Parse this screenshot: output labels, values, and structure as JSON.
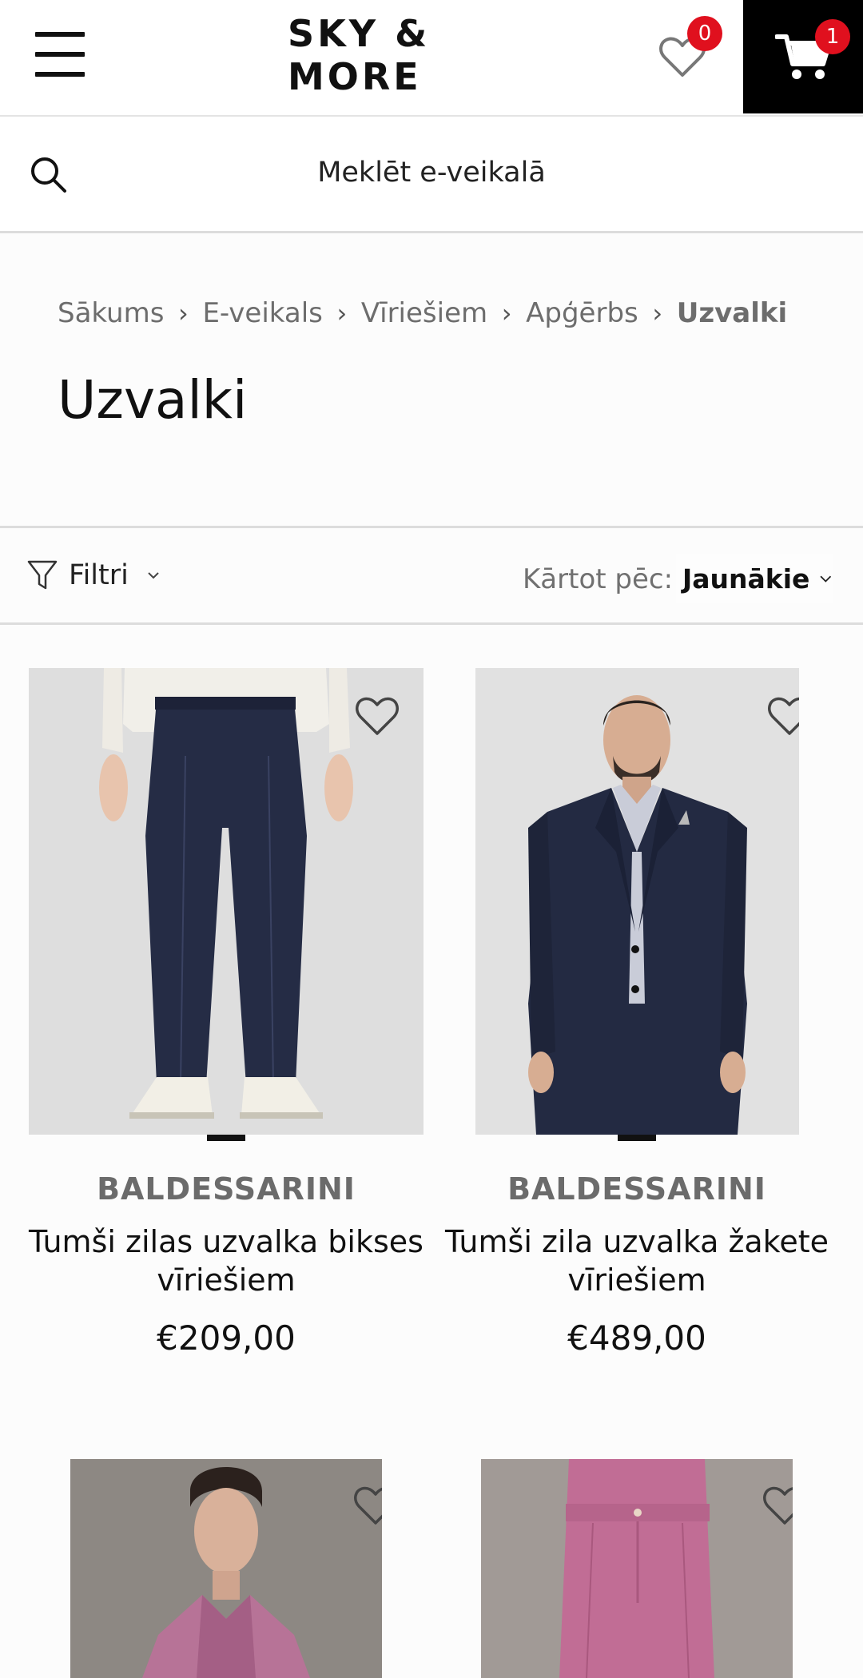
{
  "header": {
    "logo_text": "SKY & MORE",
    "wishlist_count": "0",
    "cart_count": "1"
  },
  "search": {
    "placeholder": "Meklēt e-veikalā"
  },
  "breadcrumb": [
    "Sākums",
    "E-veikals",
    "Vīriešiem",
    "Apģērbs",
    "Uzvalki"
  ],
  "page_title": "Uzvalki",
  "filterbar": {
    "filters_label": "Filtri",
    "sort_label": "Kārtot pēc:",
    "sort_value": "Jaunākie"
  },
  "products": [
    {
      "brand": "BALDESSARINI",
      "name_line1": "Tumši zilas uzvalka bikses",
      "name_line2": "vīriešiem",
      "price": "€209,00"
    },
    {
      "brand": "BALDESSARINI",
      "name_line1": "Tumši zila uzvalka žakete",
      "name_line2": "vīriešiem",
      "price": "€489,00"
    }
  ],
  "colors": {
    "accent_badge": "#e0101e",
    "cart_bg": "#000000",
    "brand_gray": "#6b6b6b"
  },
  "icons": [
    "menu-icon",
    "heart-icon",
    "cart-icon",
    "search-icon",
    "filter-icon",
    "chevron-down-icon",
    "chevron-right-icon"
  ]
}
